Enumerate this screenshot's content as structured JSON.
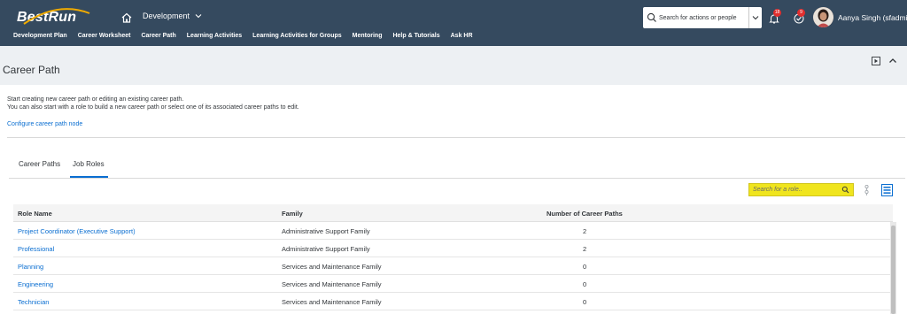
{
  "shell": {
    "logo": "BestRun",
    "environment": "Development",
    "search_placeholder": "Search for actions or people",
    "notifications_count": "18",
    "todo_count": "9",
    "user_name": "Aanya Singh (sfadmi"
  },
  "nav": {
    "items": [
      "Development Plan",
      "Career Worksheet",
      "Career Path",
      "Learning Activities",
      "Learning Activities for Groups",
      "Mentoring",
      "Help & Tutorials",
      "Ask HR"
    ]
  },
  "page": {
    "title": "Career Path"
  },
  "intro": {
    "line1": "Start creating new career path or editing an existing career path.",
    "line2": "You can also start with a role to build a new career path or select one of its associated career paths to edit.",
    "link": "Configure career path node"
  },
  "tabs": {
    "items": [
      "Career Paths",
      "Job Roles"
    ],
    "active": "Job Roles"
  },
  "toolbar": {
    "role_search_placeholder": "Search for a role.."
  },
  "table": {
    "headers": [
      "Role Name",
      "Family",
      "Number of Career Paths"
    ],
    "rows": [
      [
        "Project Coordinator (Executive Support)",
        "Administrative Support Family",
        "2"
      ],
      [
        "Professional",
        "Administrative Support Family",
        "2"
      ],
      [
        "Planning",
        "Services and Maintenance Family",
        "0"
      ],
      [
        "Engineering",
        "Services and Maintenance Family",
        "0"
      ],
      [
        "Technician",
        "Services and Maintenance Family",
        "0"
      ]
    ]
  },
  "colors": {
    "shell": "#354a5f",
    "link": "#0a6ed1",
    "highlight": "#f0e51e",
    "badge": "#e12e2e"
  },
  "icons": [
    "home-icon",
    "chevron-down-icon",
    "search-icon",
    "bell-icon",
    "task-check-icon",
    "avatar",
    "play-icon",
    "collapse-icon",
    "filter-settings-icon",
    "list-view-icon"
  ]
}
